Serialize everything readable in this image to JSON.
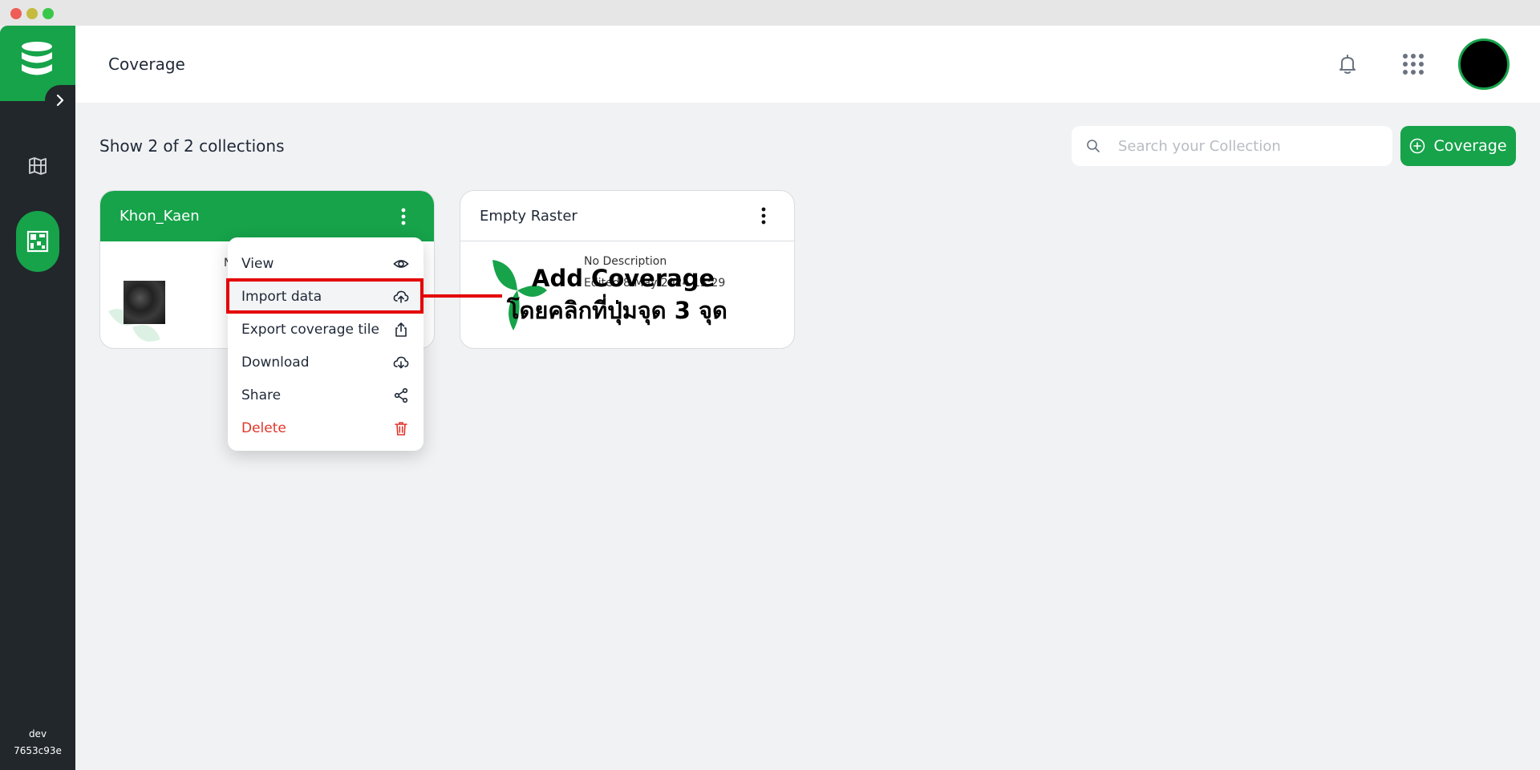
{
  "app": {
    "page_title": "Coverage",
    "env_name": "dev",
    "env_hash": "7653c93e"
  },
  "toolbar": {
    "summary": "Show 2 of 2 collections",
    "search_placeholder": "Search your Collection",
    "add_label": "Coverage"
  },
  "cards": [
    {
      "title": "Khon_Kaen",
      "desc_stub": "N"
    },
    {
      "title": "Empty Raster",
      "description": "No Description",
      "edited": "Edited 8 May 2024 13:29"
    }
  ],
  "menu": {
    "items": [
      {
        "label": "View",
        "icon": "eye-icon"
      },
      {
        "label": "Import data",
        "icon": "cloud-upload-icon"
      },
      {
        "label": "Export coverage tile",
        "icon": "share-box-icon"
      },
      {
        "label": "Download",
        "icon": "cloud-download-icon"
      },
      {
        "label": "Share",
        "icon": "share-nodes-icon"
      },
      {
        "label": "Delete",
        "icon": "trash-icon"
      }
    ]
  },
  "annotation": {
    "title": "Add Coverage",
    "subtitle": "โดยคลิกที่ปุ่มจุด 3 จุด"
  },
  "colors": {
    "brand": "#16a34a",
    "sidebar": "#22272b",
    "danger": "#e1352b",
    "highlight": "#e40000"
  }
}
